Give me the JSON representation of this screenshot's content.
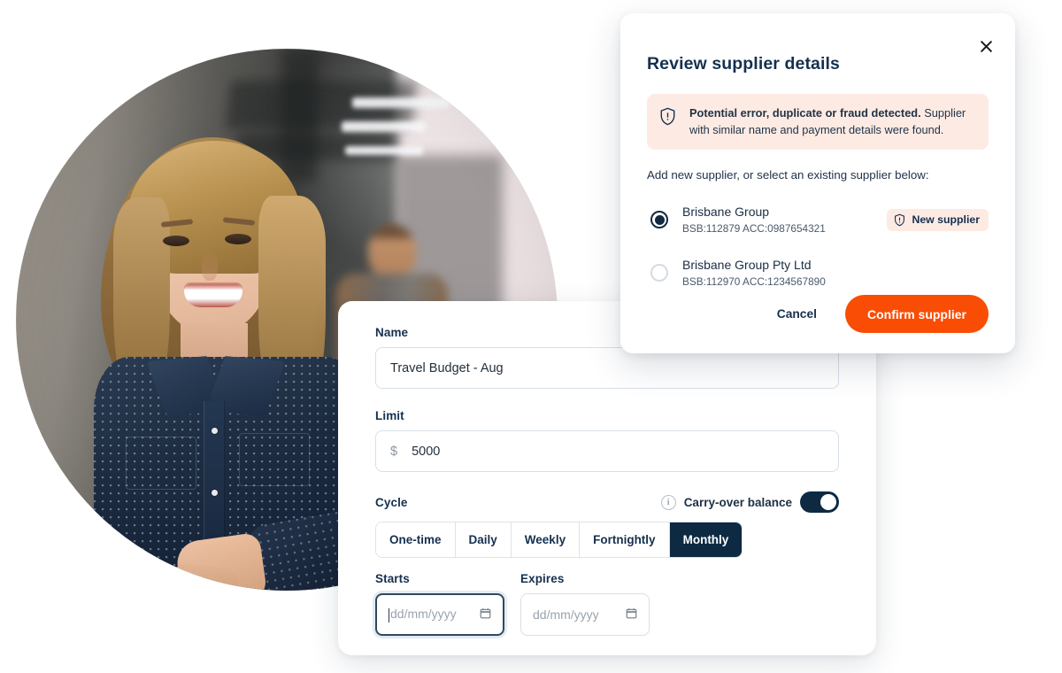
{
  "photo": {
    "alt_description": "Smiling woman in navy denim shirt holding a tablet in a workshop"
  },
  "form": {
    "name": {
      "label": "Name",
      "value": "Travel Budget - Aug"
    },
    "limit": {
      "label": "Limit",
      "currency_symbol": "$",
      "value": "5000"
    },
    "cycle": {
      "label": "Cycle",
      "options": [
        "One-time",
        "Daily",
        "Weekly",
        "Fortnightly",
        "Monthly"
      ],
      "selected": "Monthly",
      "carry_over": {
        "label": "Carry-over balance",
        "info_icon": "info-icon",
        "enabled": true
      }
    },
    "starts": {
      "label": "Starts",
      "placeholder": "dd/mm/yyyy",
      "value": "",
      "icon": "calendar-icon",
      "focused": true
    },
    "expires": {
      "label": "Expires",
      "placeholder": "dd/mm/yyyy",
      "value": "",
      "icon": "calendar-icon",
      "focused": false
    }
  },
  "modal": {
    "title": "Review supplier details",
    "close_icon": "close-icon",
    "alert": {
      "icon": "shield-alert-icon",
      "strong_text": "Potential error, duplicate or fraud detected.",
      "rest_text": " Supplier with similar name and payment details were found."
    },
    "prompt": "Add new supplier, or select an existing supplier below:",
    "suppliers": [
      {
        "name": "Brisbane Group",
        "details": "BSB:112879 ACC:0987654321",
        "selected": true,
        "badge": {
          "icon": "shield-alert-icon",
          "label": "New supplier"
        }
      },
      {
        "name": "Brisbane Group Pty Ltd",
        "details": "BSB:112970 ACC:1234567890",
        "selected": false,
        "badge": null
      }
    ],
    "actions": {
      "cancel_label": "Cancel",
      "confirm_label": "Confirm supplier"
    }
  },
  "colors": {
    "accent_orange": "#f94d06",
    "navy": "#0e2a43",
    "alert_bg": "#fdebe3",
    "label_navy": "#15304f"
  }
}
